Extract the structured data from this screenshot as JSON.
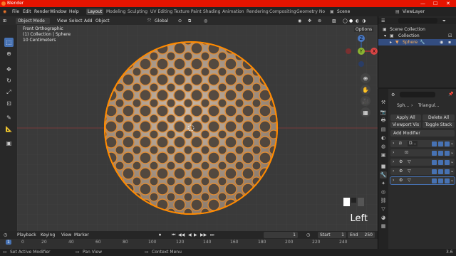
{
  "window": {
    "title": "Blender",
    "controls": [
      "—",
      "☐",
      "✕"
    ]
  },
  "menu": {
    "items": [
      "File",
      "Edit",
      "Render",
      "Window",
      "Help"
    ],
    "workspaces": [
      "Layout",
      "Modeling",
      "Sculpting",
      "UV Editing",
      "Texture Paint",
      "Shading",
      "Animation",
      "Rendering",
      "Compositing",
      "Geometry No"
    ],
    "active_workspace": "Layout",
    "scene": "Scene",
    "view_layer": "ViewLayer"
  },
  "header": {
    "mode": "Object Mode",
    "menus": [
      "View",
      "Select",
      "Add",
      "Object"
    ],
    "orientation": "Global",
    "options": "Options"
  },
  "viewport": {
    "line1": "Front Orthographic",
    "line2": "(1) Collection | Sphere",
    "line3": "10 Centimeters",
    "overlay_label": "Left",
    "gizmo": {
      "x": "X",
      "y": "Y",
      "z": "Z"
    }
  },
  "timeline": {
    "menus": [
      "Playback",
      "Keying",
      "View",
      "Marker"
    ],
    "current_frame": "1",
    "start_label": "Start",
    "start": "1",
    "end_label": "End",
    "end": "250"
  },
  "ruler": {
    "ticks": [
      "0",
      "20",
      "40",
      "60",
      "80",
      "100",
      "120",
      "140",
      "160",
      "180",
      "200",
      "220",
      "240"
    ],
    "current": "1"
  },
  "status": {
    "left": "Set Active Modifier",
    "middle": "Pan View",
    "right": "Context Menu",
    "version": "3.6"
  },
  "outliner": {
    "root": "Scene Collection",
    "collection": "Collection",
    "object": "Sphere"
  },
  "properties": {
    "object_name": "Sph...",
    "modifier_name": "Triangul...",
    "apply_all": "Apply All",
    "delete_all": "Delete All",
    "viewport_vis": "Viewport Vis",
    "toggle_stack": "Toggle Stack",
    "add_modifier": "Add Modifier",
    "modifiers": [
      {
        "name": "D..."
      },
      {
        "name": ""
      },
      {
        "name": ""
      },
      {
        "name": ""
      },
      {
        "name": ""
      }
    ]
  },
  "colors": {
    "titlebar": "#e51400",
    "accent": "#4772b3",
    "selection": "#ff8a00"
  }
}
